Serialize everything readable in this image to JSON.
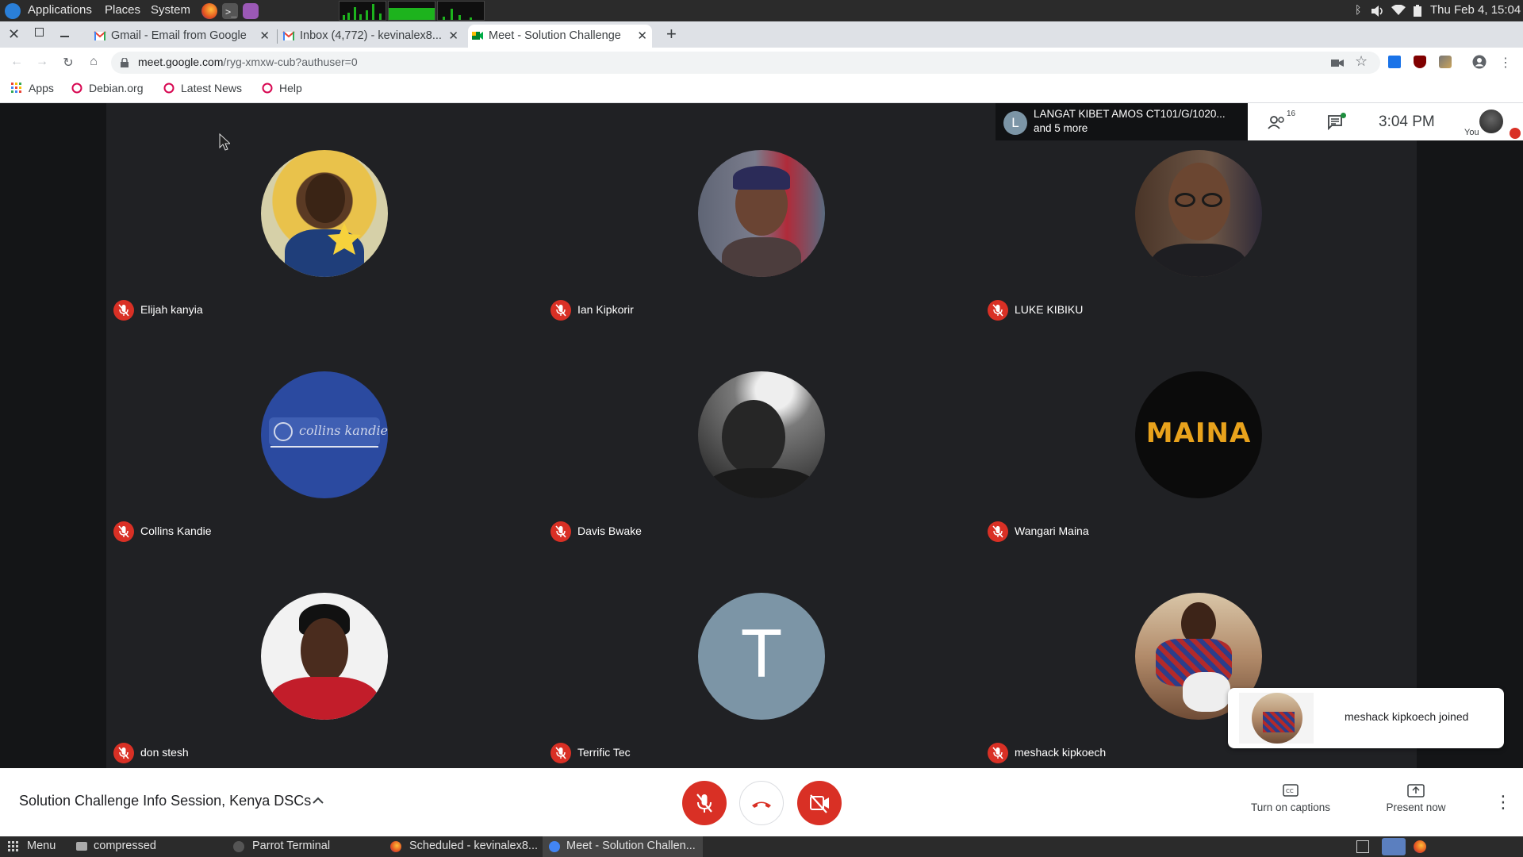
{
  "os_panel": {
    "menus": [
      "Applications",
      "Places",
      "System"
    ],
    "clock": "Thu Feb  4, 15:04"
  },
  "browser": {
    "tabs": [
      {
        "label": "Gmail - Email from Google",
        "icon": "gmail-icon"
      },
      {
        "label": "Inbox (4,772) - kevinalex8...",
        "icon": "gmail-icon"
      },
      {
        "label": "Meet - Solution Challenge",
        "icon": "meet-icon",
        "active": true
      }
    ],
    "new_tab": "+",
    "url_main": "meet.google.com",
    "url_path": "/ryg-xmxw-cub?authuser=0",
    "bookmarks": [
      "Apps",
      "Debian.org",
      "Latest News",
      "Help"
    ]
  },
  "meet": {
    "presenter_line1": "LANGAT KIBET AMOS CT101/G/1020...",
    "presenter_line2": "and 5 more",
    "presenter_initial": "L",
    "participant_count": "16",
    "time": "3:04 PM",
    "self_label": "You",
    "participants": [
      {
        "name": "Elijah kanyia",
        "avatar": "photo",
        "color": "#c9a93a"
      },
      {
        "name": "Ian Kipkorir",
        "avatar": "photo",
        "color": "#8a7a86"
      },
      {
        "name": "LUKE KIBIKU",
        "avatar": "photo",
        "color": "#4a3b33"
      },
      {
        "name": "Collins Kandie",
        "avatar": "logo",
        "color": "#2b4aa0",
        "logo_text": "collins kandie"
      },
      {
        "name": "Davis Bwake",
        "avatar": "photo",
        "color": "#555555"
      },
      {
        "name": "Wangari Maina",
        "avatar": "logo",
        "color": "#0b0b0b",
        "logo_text": "MAINA"
      },
      {
        "name": "don stesh",
        "avatar": "photo",
        "color": "#c21d2a"
      },
      {
        "name": "Terrific Tec",
        "avatar": "initial",
        "color": "#7c95a6",
        "initial": "T"
      },
      {
        "name": "meshack kipkoech",
        "avatar": "photo",
        "color": "#7b4a3a"
      }
    ],
    "toast_text": "meshack kipkoech joined",
    "meeting_title": "Solution Challenge Info Session, Kenya DSCs",
    "captions_label": "Turn on captions",
    "present_label": "Present now",
    "brand_red": "#d93025"
  },
  "taskbar": {
    "menu": "Menu",
    "items": [
      "compressed",
      "Parrot Terminal",
      "Scheduled - kevinalex8...",
      "Meet - Solution Challen..."
    ]
  }
}
